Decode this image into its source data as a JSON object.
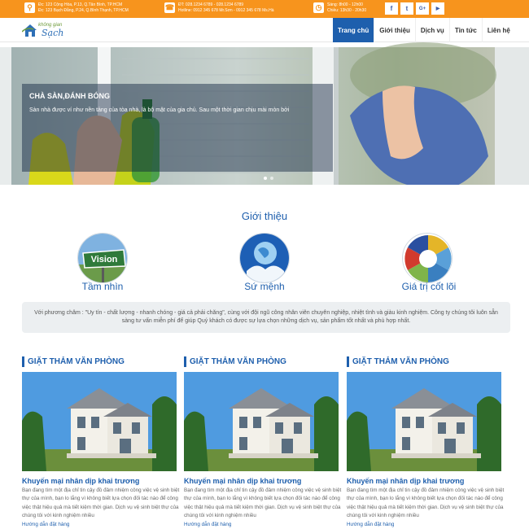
{
  "topbar": {
    "address": [
      "Đc: 123 Cộng Hòa, P.13, Q.Tân Bình, TP.HCM",
      "Đc: 123 Bạch Đằng, P.24, Q.Bình Thạnh, TP.HCM"
    ],
    "phone": [
      "ĐT: 028.1234 6789 - 028.1234 6789",
      "Hotline: 0912 345 678 Mr.Sơn - 0912 345 678 Ms.Hà"
    ],
    "hours": [
      "Sáng: 8h00 - 12h00",
      "Chiều: 13h30 - 20h30"
    ],
    "social": [
      {
        "icon": "facebook-icon",
        "glyph": "f"
      },
      {
        "icon": "twitter-icon",
        "glyph": "t"
      },
      {
        "icon": "google-plus-icon",
        "glyph": "G+"
      },
      {
        "icon": "youtube-icon",
        "glyph": "▶"
      }
    ],
    "color": "#f7941d"
  },
  "header": {
    "logo_small": "không gian",
    "logo_big": "Sạch",
    "nav": [
      {
        "label": "Trang chủ",
        "active": true
      },
      {
        "label": "Giới thiệu",
        "active": false
      },
      {
        "label": "Dịch vụ",
        "active": false
      },
      {
        "label": "Tin tức",
        "active": false
      },
      {
        "label": "Liên hệ",
        "active": false
      }
    ],
    "accent": "#1e5fad"
  },
  "slider": {
    "title": "CHÀ SÀN,ĐÁNH BÓNG",
    "text": "Sàn nhà được ví như nền tảng của tòa nhà, là bộ mặt của gia chủ. Sau một thời gian chịu mài mòn bởi",
    "slide_count": 2,
    "active_slide": 1
  },
  "intro": {
    "title": "Giới thiệu",
    "items": [
      {
        "label": "Tầm nhìn",
        "image_text": "Vision",
        "icon": "vision-sign-icon"
      },
      {
        "label": "Sứ mệnh",
        "icon": "globe-hands-icon"
      },
      {
        "label": "Giá trị cốt lõi",
        "icon": "core-values-wheel-icon"
      }
    ],
    "mission": "Với phương châm : \"Uy tín - chất lượng - nhanh chóng - giá cả phải chăng\", cùng với đội ngũ công nhân viên chuyên nghiệp, nhiệt tình và giàu kinh nghiệm. Công ty chúng tôi luôn sẵn sàng tư vấn miễn phí để giúp Quý khách có được sự lựa chọn những dịch vụ, sản phẩm tốt nhất và phù hợp nhất."
  },
  "cards": [
    {
      "title": "GIẶT THẢM VĂN PHÒNG",
      "subtitle": "Khuyến mại nhân dịp khai trương",
      "text": "Bạn đang tìm một địa chỉ tin cậy đồ đảm nhiệm công việc vệ sinh biệt thự của mình, bạn lo lắng vì không biết lựa chọn đối tác nào để công việc thật hiệu quả mà tiết kiệm thời gian. Dịch vụ vệ sinh biệt thự của chúng tôi với kinh nghiệm nhiều",
      "link": "Hướng dẫn đặt hàng"
    },
    {
      "title": "GIẶT THẢM VĂN PHÒNG",
      "subtitle": "Khuyến mại nhân dịp khai trương",
      "text": "Bạn đang tìm một địa chỉ tin cậy đồ đảm nhiệm công việc vệ sinh biệt thự của mình, bạn lo lắng vì không biết lựa chọn đối tác nào để công việc thật hiệu quả mà tiết kiệm thời gian. Dịch vụ vệ sinh biệt thự của chúng tôi với kinh nghiệm nhiều",
      "link": "Hướng dẫn đặt hàng"
    },
    {
      "title": "GIẶT THẢM VĂN PHÒNG",
      "subtitle": "Khuyến mại nhân dịp khai trương",
      "text": "Bạn đang tìm một địa chỉ tin cậy đồ đảm nhiệm công việc vệ sinh biệt thự của mình, bạn lo lắng vì không biết lựa chọn đối tác nào để công việc thật hiệu quả mà tiết kiệm thời gian. Dịch vụ vệ sinh biệt thự của chúng tôi với kinh nghiệm nhiều",
      "link": "Hướng dẫn đặt hàng"
    }
  ]
}
